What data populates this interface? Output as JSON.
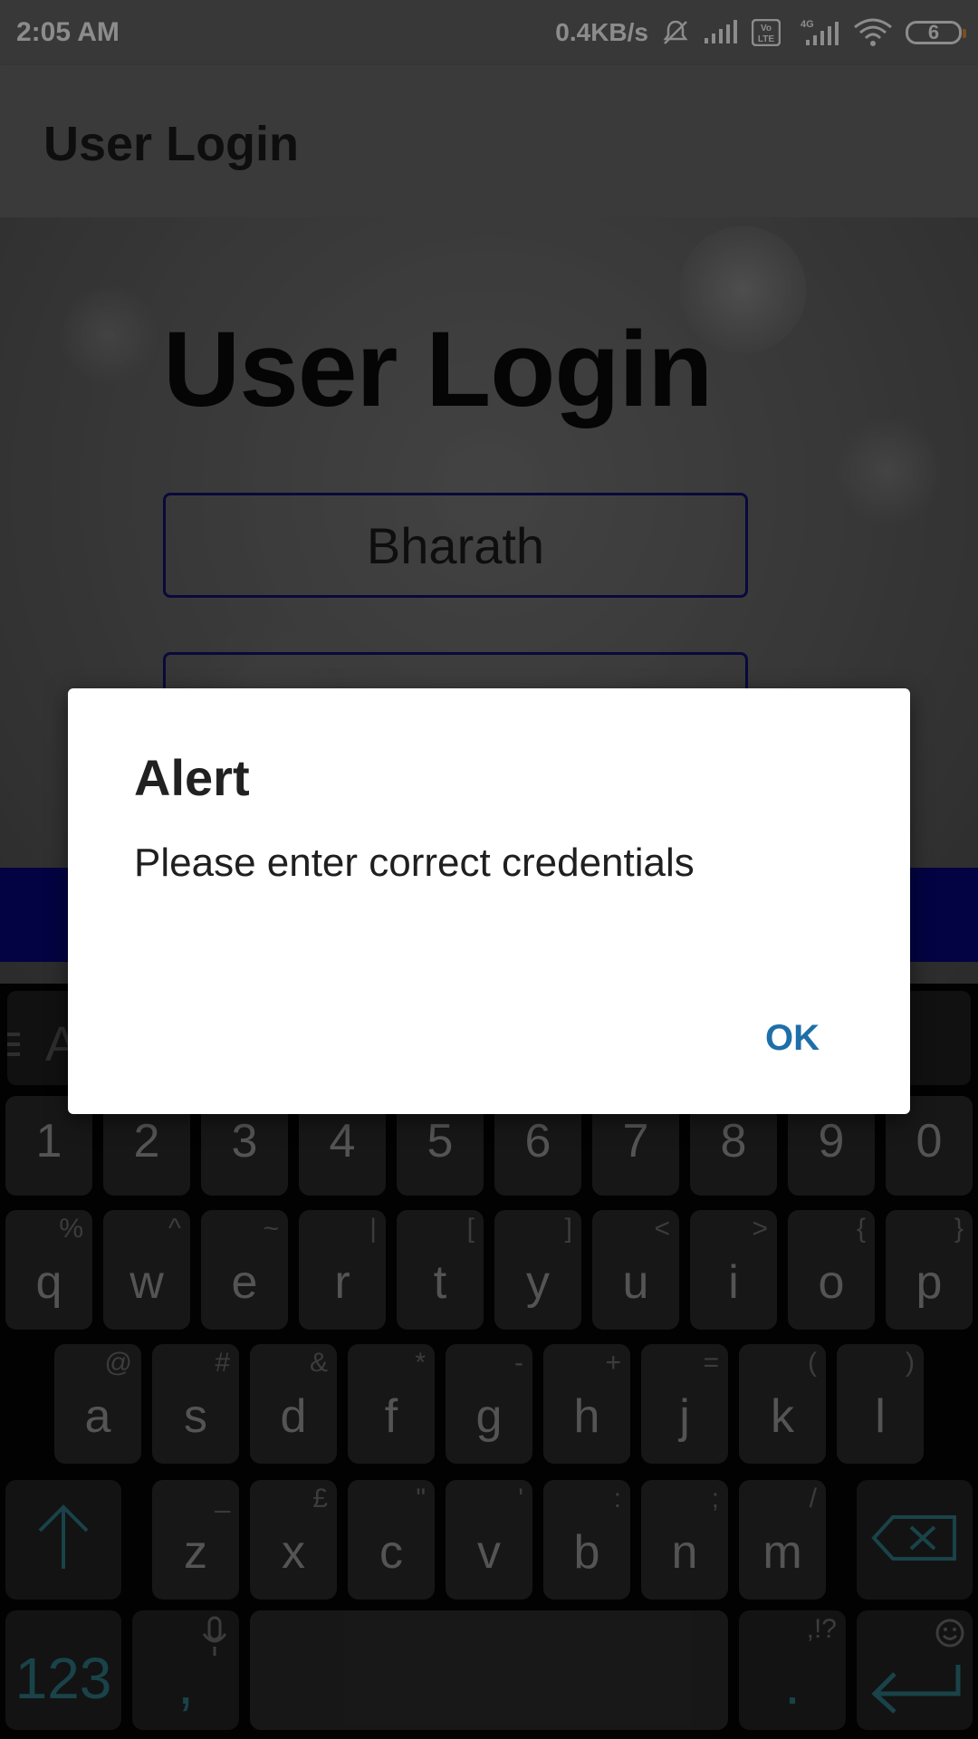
{
  "status_bar": {
    "time": "2:05 AM",
    "net_speed": "0.4KB/s",
    "battery_level": "6",
    "icons": [
      "mute-bell-icon",
      "signal-icon",
      "volte-icon",
      "4g-signal-icon",
      "wifi-icon",
      "battery-icon"
    ]
  },
  "app_bar": {
    "title": "User Login"
  },
  "content": {
    "heading": "User Login",
    "username_value": "Bharath"
  },
  "keyboard": {
    "suggestion_partial": "A",
    "number_row": [
      "1",
      "2",
      "3",
      "4",
      "5",
      "6",
      "7",
      "8",
      "9",
      "0"
    ],
    "row1": [
      {
        "k": "q",
        "s": "%"
      },
      {
        "k": "w",
        "s": "^"
      },
      {
        "k": "e",
        "s": "~"
      },
      {
        "k": "r",
        "s": "|"
      },
      {
        "k": "t",
        "s": "["
      },
      {
        "k": "y",
        "s": "]"
      },
      {
        "k": "u",
        "s": "<"
      },
      {
        "k": "i",
        "s": ">"
      },
      {
        "k": "o",
        "s": "{"
      },
      {
        "k": "p",
        "s": "}"
      }
    ],
    "row2": [
      {
        "k": "a",
        "s": "@"
      },
      {
        "k": "s",
        "s": "#"
      },
      {
        "k": "d",
        "s": "&"
      },
      {
        "k": "f",
        "s": "*"
      },
      {
        "k": "g",
        "s": "-"
      },
      {
        "k": "h",
        "s": "+"
      },
      {
        "k": "j",
        "s": "="
      },
      {
        "k": "k",
        "s": "("
      },
      {
        "k": "l",
        "s": ")"
      }
    ],
    "row3": [
      {
        "k": "z",
        "s": "_"
      },
      {
        "k": "x",
        "s": "£"
      },
      {
        "k": "c",
        "s": "\""
      },
      {
        "k": "v",
        "s": "'"
      },
      {
        "k": "b",
        "s": ":"
      },
      {
        "k": "n",
        "s": ";"
      },
      {
        "k": "m",
        "s": "/"
      }
    ],
    "symbols_key": "123",
    "comma_key": ",",
    "period_key": ".",
    "period_sub": ",!?"
  },
  "dialog": {
    "title": "Alert",
    "message": "Please enter correct credentials",
    "ok_label": "OK"
  },
  "colors": {
    "accent_button": "#06067a",
    "dialog_ok": "#1e6fa8",
    "keyboard_accent": "#2f7a86"
  }
}
